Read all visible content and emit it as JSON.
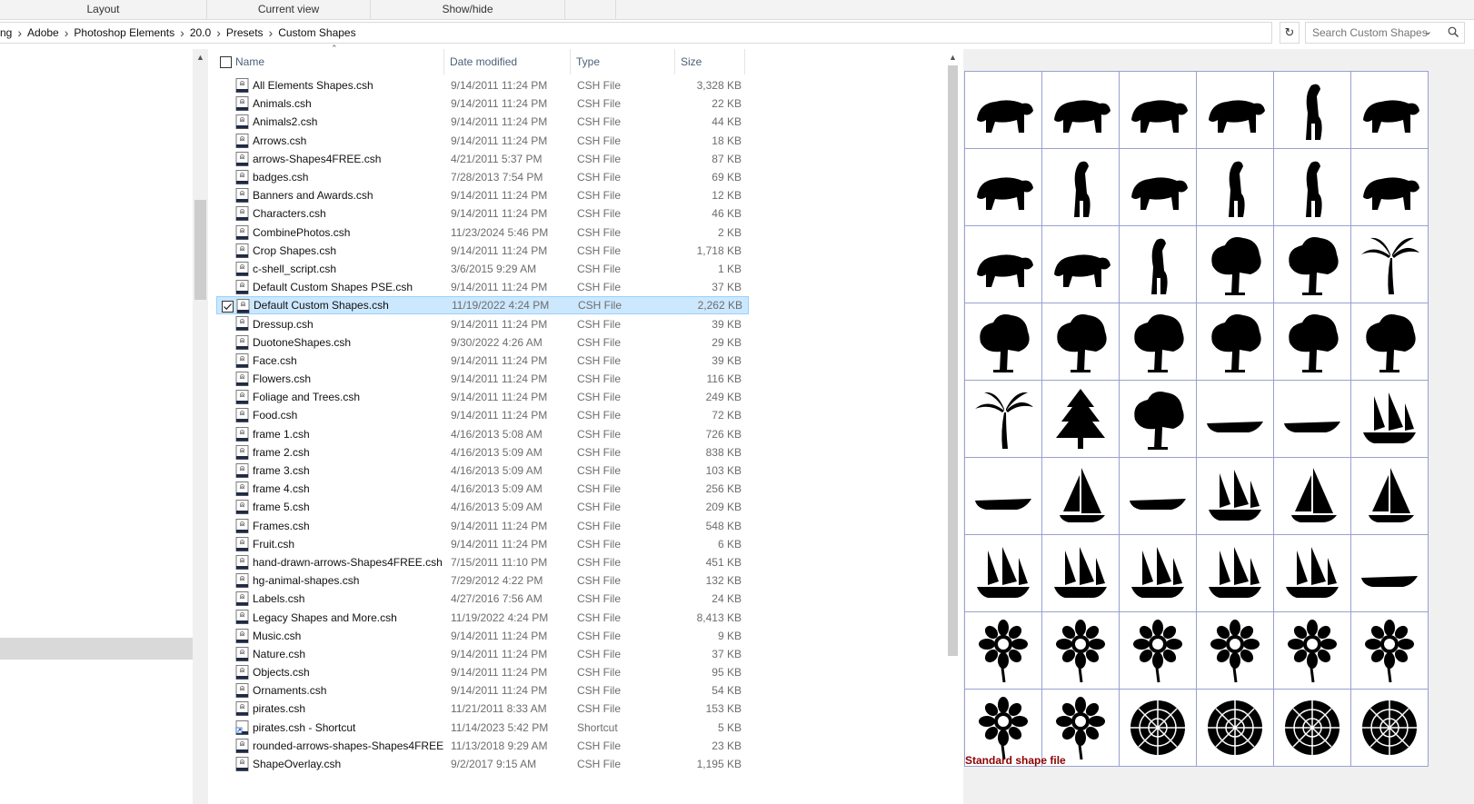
{
  "ribbon": {
    "layout": "Layout",
    "current_view": "Current view",
    "show_hide": "Show/hide"
  },
  "address": {
    "crumbs": [
      "ng",
      "Adobe",
      "Photoshop Elements",
      "20.0",
      "Presets",
      "Custom Shapes"
    ],
    "search_placeholder": "Search Custom Shapes"
  },
  "columns": {
    "name": "Name",
    "date": "Date modified",
    "type": "Type",
    "size": "Size"
  },
  "files": [
    {
      "name": "All Elements Shapes.csh",
      "date": "9/14/2011 11:24 PM",
      "type": "CSH File",
      "size": "3,328 KB"
    },
    {
      "name": "Animals.csh",
      "date": "9/14/2011 11:24 PM",
      "type": "CSH File",
      "size": "22 KB"
    },
    {
      "name": "Animals2.csh",
      "date": "9/14/2011 11:24 PM",
      "type": "CSH File",
      "size": "44 KB"
    },
    {
      "name": "Arrows.csh",
      "date": "9/14/2011 11:24 PM",
      "type": "CSH File",
      "size": "18 KB"
    },
    {
      "name": "arrows-Shapes4FREE.csh",
      "date": "4/21/2011 5:37 PM",
      "type": "CSH File",
      "size": "87 KB"
    },
    {
      "name": "badges.csh",
      "date": "7/28/2013 7:54 PM",
      "type": "CSH File",
      "size": "69 KB"
    },
    {
      "name": "Banners and Awards.csh",
      "date": "9/14/2011 11:24 PM",
      "type": "CSH File",
      "size": "12 KB"
    },
    {
      "name": "Characters.csh",
      "date": "9/14/2011 11:24 PM",
      "type": "CSH File",
      "size": "46 KB"
    },
    {
      "name": "CombinePhotos.csh",
      "date": "11/23/2024 5:46 PM",
      "type": "CSH File",
      "size": "2 KB"
    },
    {
      "name": "Crop Shapes.csh",
      "date": "9/14/2011 11:24 PM",
      "type": "CSH File",
      "size": "1,718 KB"
    },
    {
      "name": "c-shell_script.csh",
      "date": "3/6/2015 9:29 AM",
      "type": "CSH File",
      "size": "1 KB"
    },
    {
      "name": "Default Custom Shapes PSE.csh",
      "date": "9/14/2011 11:24 PM",
      "type": "CSH File",
      "size": "37 KB"
    },
    {
      "name": "Default Custom Shapes.csh",
      "date": "11/19/2022 4:24 PM",
      "type": "CSH File",
      "size": "2,262 KB",
      "selected": true
    },
    {
      "name": "Dressup.csh",
      "date": "9/14/2011 11:24 PM",
      "type": "CSH File",
      "size": "39 KB"
    },
    {
      "name": "DuotoneShapes.csh",
      "date": "9/30/2022 4:26 AM",
      "type": "CSH File",
      "size": "29 KB"
    },
    {
      "name": "Face.csh",
      "date": "9/14/2011 11:24 PM",
      "type": "CSH File",
      "size": "39 KB"
    },
    {
      "name": "Flowers.csh",
      "date": "9/14/2011 11:24 PM",
      "type": "CSH File",
      "size": "116 KB"
    },
    {
      "name": "Foliage and Trees.csh",
      "date": "9/14/2011 11:24 PM",
      "type": "CSH File",
      "size": "249 KB"
    },
    {
      "name": "Food.csh",
      "date": "9/14/2011 11:24 PM",
      "type": "CSH File",
      "size": "72 KB"
    },
    {
      "name": "frame 1.csh",
      "date": "4/16/2013 5:08 AM",
      "type": "CSH File",
      "size": "726 KB"
    },
    {
      "name": "frame 2.csh",
      "date": "4/16/2013 5:09 AM",
      "type": "CSH File",
      "size": "838 KB"
    },
    {
      "name": "frame 3.csh",
      "date": "4/16/2013 5:09 AM",
      "type": "CSH File",
      "size": "103 KB"
    },
    {
      "name": "frame 4.csh",
      "date": "4/16/2013 5:09 AM",
      "type": "CSH File",
      "size": "256 KB"
    },
    {
      "name": "frame 5.csh",
      "date": "4/16/2013 5:09 AM",
      "type": "CSH File",
      "size": "209 KB"
    },
    {
      "name": "Frames.csh",
      "date": "9/14/2011 11:24 PM",
      "type": "CSH File",
      "size": "548 KB"
    },
    {
      "name": "Fruit.csh",
      "date": "9/14/2011 11:24 PM",
      "type": "CSH File",
      "size": "6 KB"
    },
    {
      "name": "hand-drawn-arrows-Shapes4FREE.csh",
      "date": "7/15/2011 11:10 PM",
      "type": "CSH File",
      "size": "451 KB"
    },
    {
      "name": "hg-animal-shapes.csh",
      "date": "7/29/2012 4:22 PM",
      "type": "CSH File",
      "size": "132 KB"
    },
    {
      "name": "Labels.csh",
      "date": "4/27/2016 7:56 AM",
      "type": "CSH File",
      "size": "24 KB"
    },
    {
      "name": "Legacy Shapes and More.csh",
      "date": "11/19/2022 4:24 PM",
      "type": "CSH File",
      "size": "8,413 KB"
    },
    {
      "name": "Music.csh",
      "date": "9/14/2011 11:24 PM",
      "type": "CSH File",
      "size": "9 KB"
    },
    {
      "name": "Nature.csh",
      "date": "9/14/2011 11:24 PM",
      "type": "CSH File",
      "size": "37 KB"
    },
    {
      "name": "Objects.csh",
      "date": "9/14/2011 11:24 PM",
      "type": "CSH File",
      "size": "95 KB"
    },
    {
      "name": "Ornaments.csh",
      "date": "9/14/2011 11:24 PM",
      "type": "CSH File",
      "size": "54 KB"
    },
    {
      "name": "pirates.csh",
      "date": "11/21/2011 8:33 AM",
      "type": "CSH File",
      "size": "153 KB"
    },
    {
      "name": "pirates.csh - Shortcut",
      "date": "11/14/2023 5:42 PM",
      "type": "Shortcut",
      "size": "5 KB",
      "shortcut": true
    },
    {
      "name": "rounded-arrows-shapes-Shapes4FREE....",
      "date": "11/13/2018 9:29 AM",
      "type": "CSH File",
      "size": "23 KB"
    },
    {
      "name": "ShapeOverlay.csh",
      "date": "9/2/2017 9:15 AM",
      "type": "CSH File",
      "size": "1,195 KB"
    }
  ],
  "preview": {
    "label": "Standard shape file",
    "shapes": [
      "tiger-icon",
      "lion-icon",
      "rhino-icon",
      "monkey-icon",
      "wolf-icon",
      "camel-icon",
      "mole-icon",
      "giraffe-icon",
      "kangaroo-icon",
      "gorilla-icon",
      "deer-leaping-icon",
      "elephant-icon",
      "cougar-icon",
      "moose-icon",
      "stag-icon",
      "acacia-tree-icon",
      "bonsai-tree-icon",
      "palm-tree-icon",
      "oak-tree-icon",
      "baobab-tree-icon",
      "willow-tree-icon",
      "round-tree-icon",
      "bushy-tree-icon",
      "leafy-tree-icon",
      "palm-tree-2-icon",
      "fir-tree-icon",
      "big-oak-icon",
      "canoe-icon",
      "raft-icon",
      "clipper-ship-icon",
      "rowboat-icon",
      "sailboat-icon",
      "kayak-icon",
      "schooner-icon",
      "yacht-icon",
      "sail-racer-icon",
      "tall-ship-icon",
      "cruise-ship-icon",
      "galleon-icon",
      "frigate-icon",
      "brig-icon",
      "submarine-icon",
      "daisy-bunch-icon",
      "flower-stem-icon",
      "flower-cluster-icon",
      "lily-icon",
      "pansy-icon",
      "tulip-swirl-icon",
      "berry-sprig-icon",
      "poinsettia-icon",
      "rose-icon",
      "hibiscus-icon",
      "chrysanthemum-icon",
      "ornate-flower-icon"
    ]
  }
}
